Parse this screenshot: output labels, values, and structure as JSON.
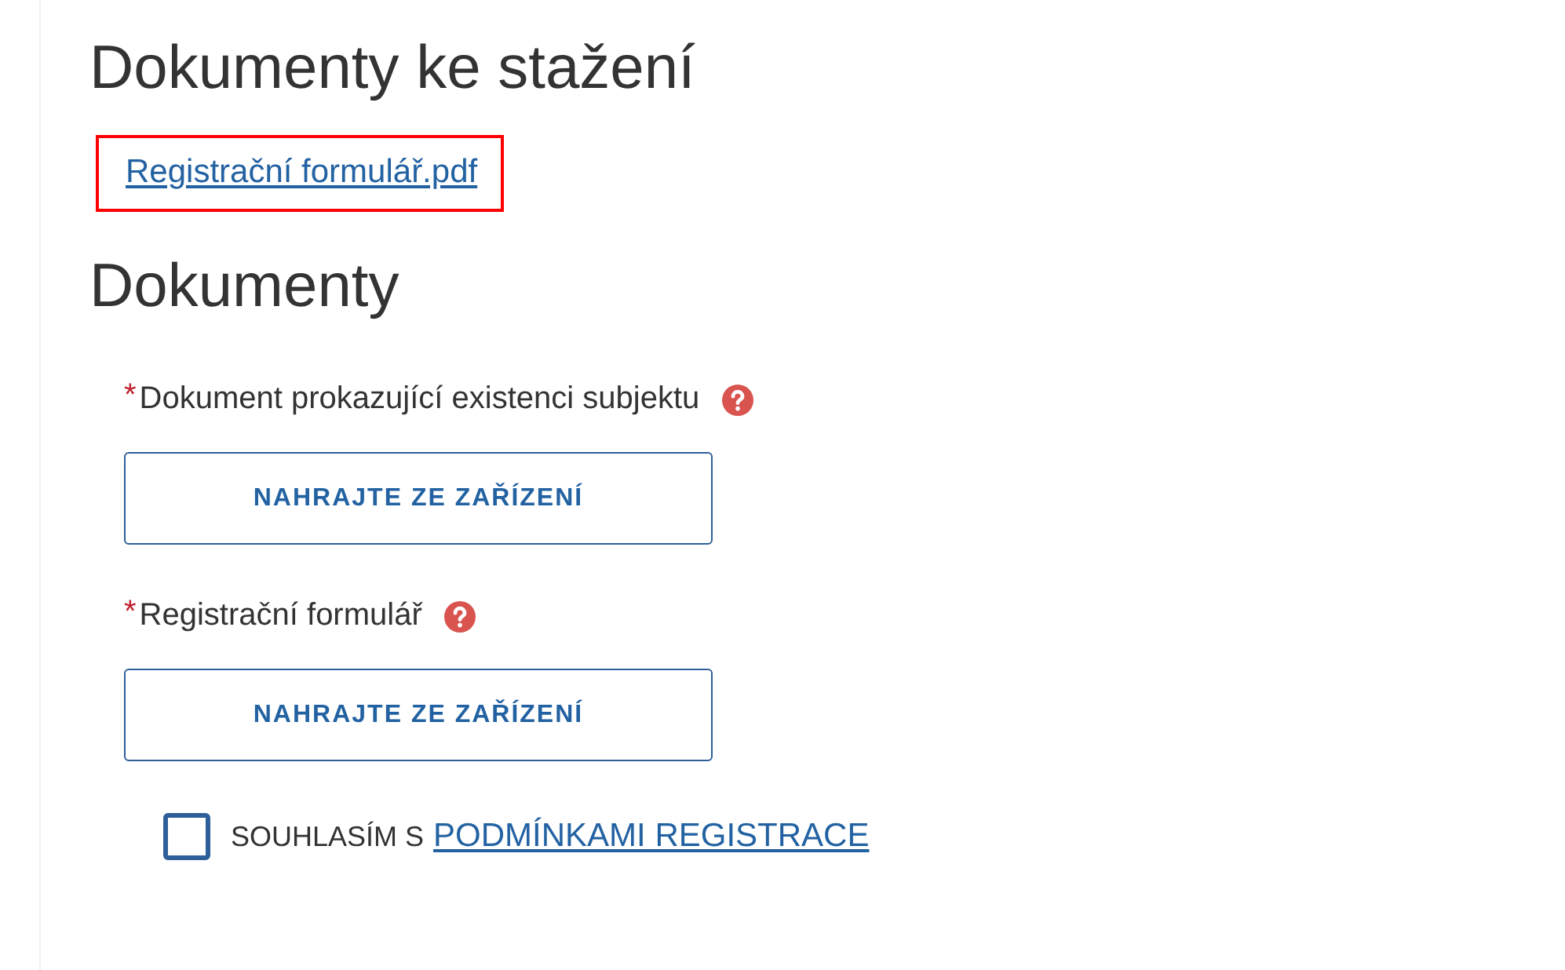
{
  "download_section": {
    "title": "Dokumenty ke stažení",
    "links": [
      {
        "label": "Registrační formulář.pdf",
        "highlighted": true
      }
    ]
  },
  "documents_section": {
    "title": "Dokumenty",
    "fields": [
      {
        "required_mark": "*",
        "label": "Dokument prokazující existenci subjektu",
        "help": true,
        "button": "NAHRAJTE ZE ZAŘÍZENÍ"
      },
      {
        "required_mark": "*",
        "label": "Registrační formulář",
        "help": true,
        "button": "NAHRAJTE ZE ZAŘÍZENÍ"
      }
    ]
  },
  "consent": {
    "checked": false,
    "text": "SOUHLASÍM S",
    "link": "PODMÍNKAMI REGISTRACE"
  }
}
